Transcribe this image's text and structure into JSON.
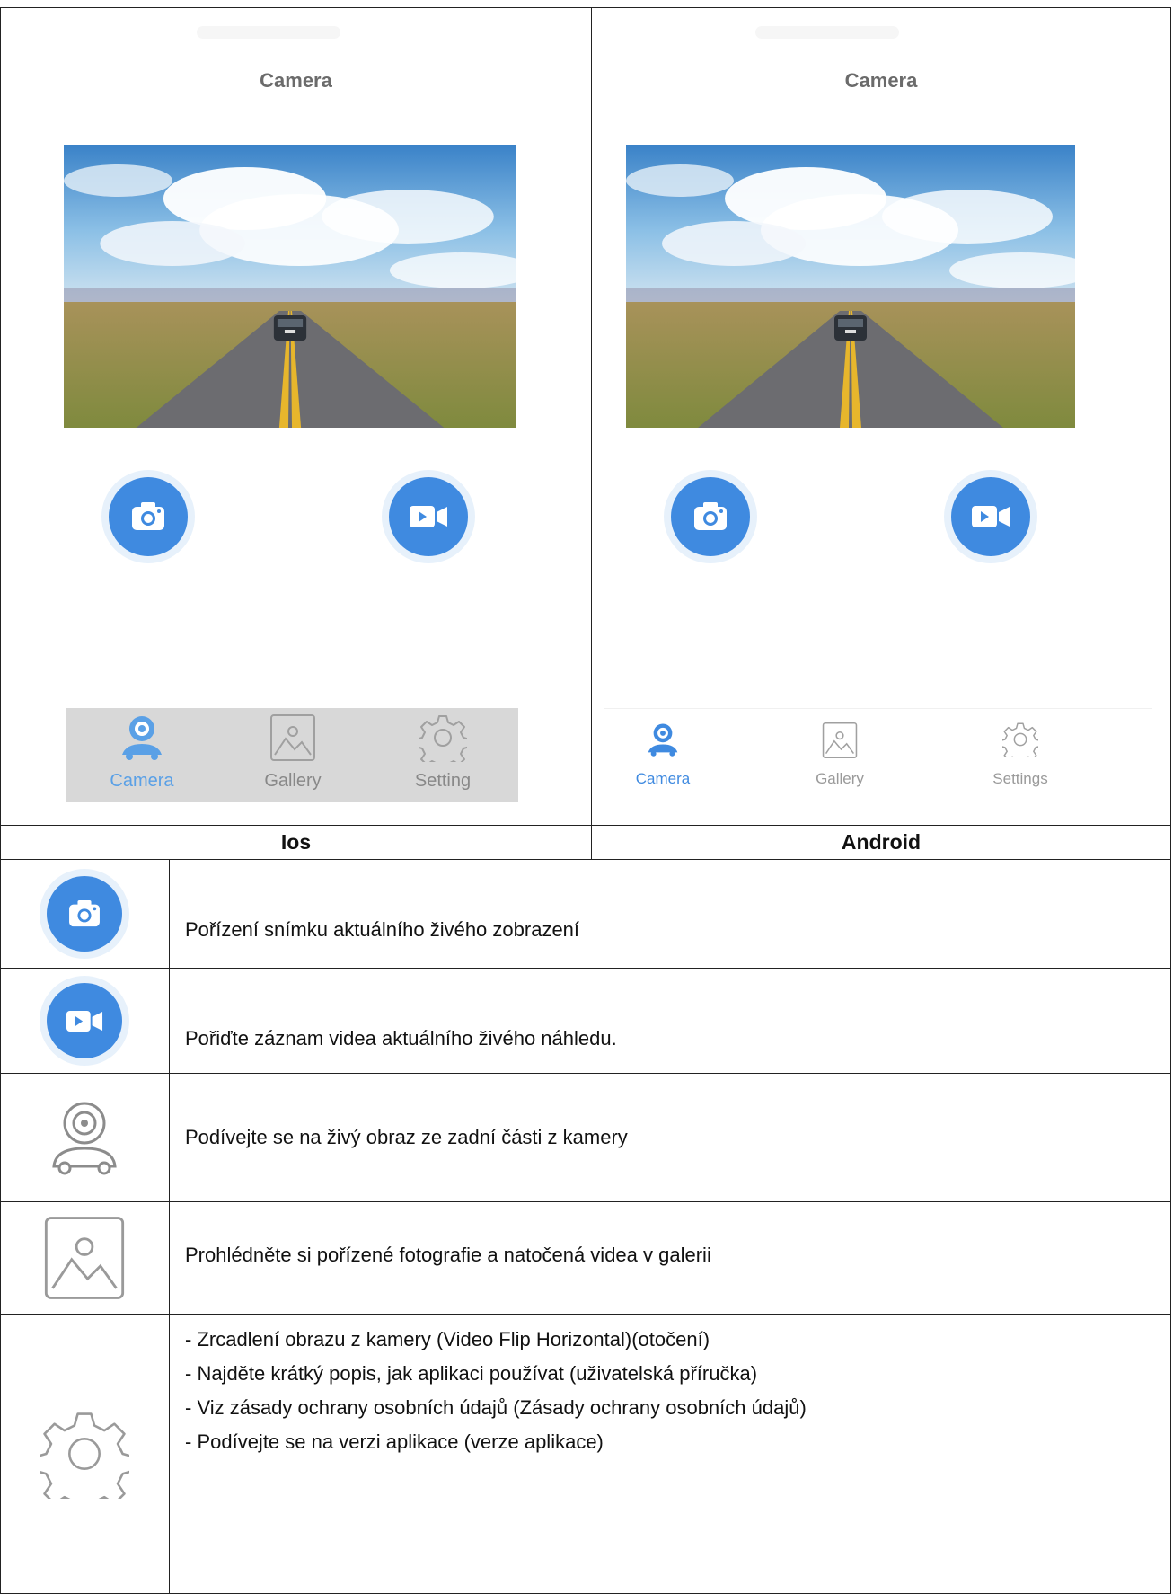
{
  "ios_panel": {
    "title": "Camera",
    "tabs": [
      {
        "label": "Camera",
        "icon": "camera-tab-icon",
        "active": true
      },
      {
        "label": "Gallery",
        "icon": "gallery-icon",
        "active": false
      },
      {
        "label": "Setting",
        "icon": "gear-icon",
        "active": false
      }
    ]
  },
  "android_panel": {
    "title": "Camera",
    "tabs": [
      {
        "label": "Camera",
        "icon": "camera-tab-icon",
        "active": true
      },
      {
        "label": "Gallery",
        "icon": "gallery-icon",
        "active": false
      },
      {
        "label": "Settings",
        "icon": "gear-icon",
        "active": false
      }
    ]
  },
  "platforms": {
    "ios": "Ios",
    "android": "Android"
  },
  "features": [
    {
      "icon": "photo-camera-icon",
      "text": "Pořízení snímku aktuálního živého zobrazení"
    },
    {
      "icon": "video-camera-icon",
      "text": "Pořiďte záznam videa aktuálního živého náhledu."
    },
    {
      "icon": "camera-tab-icon",
      "text": "Podívejte se na živý obraz ze zadní části z kamery"
    },
    {
      "icon": "gallery-icon",
      "text": "Prohlédněte si pořízené fotografie a natočená videa v galerii"
    },
    {
      "icon": "gear-icon",
      "lines": [
        "- Zrcadlení obrazu z kamery (Video Flip Horizontal)(otočení)",
        "- Najděte krátký popis, jak aplikaci používat (uživatelská příručka)",
        "- Viz zásady ochrany osobních údajů (Zásady ochrany osobních údajů)",
        "- Podívejte se na verzi aplikace (verze aplikace)"
      ]
    }
  ],
  "colors": {
    "accent_blue": "#3f8ae0",
    "button_halo": "#e7f1fb",
    "ios_tabbar_bg": "#d8d8d8",
    "inactive_icon": "#a0a0a0"
  }
}
